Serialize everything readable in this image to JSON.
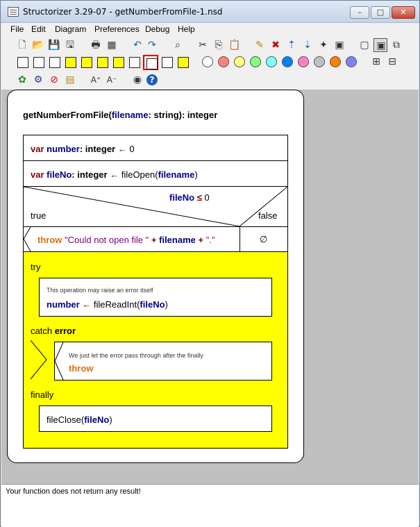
{
  "window": {
    "title": "Structorizer 3.29-07 - getNumberFromFile-1.nsd"
  },
  "menu": [
    "File",
    "Edit",
    "Diagram",
    "Preferences",
    "Debug",
    "Help"
  ],
  "toolbar": {
    "row1_icons": [
      "new-icon",
      "open-icon",
      "save-icon",
      "save-as-icon",
      "print-icon",
      "export-icon",
      "undo-icon",
      "redo-icon",
      "find-icon",
      "cut-icon",
      "copy-icon",
      "paste-icon",
      "edit-icon",
      "delete-icon",
      "move-up-icon",
      "move-down-icon",
      "transmute-icon",
      "collapse-icon",
      "view-icon-1",
      "view-icon-2",
      "view-icon-3"
    ],
    "colors": [
      "#ffffff",
      "#ff8080",
      "#ffff80",
      "#80ff80",
      "#80ffff",
      "#0080ff",
      "#ff80c0",
      "#c0c0c0",
      "#ff8000",
      "#8080ff"
    ],
    "row3_icons": [
      "turtle-icon",
      "settings-icon",
      "no-analysis-icon",
      "analysis-icon",
      "font-up-icon",
      "font-down-icon",
      "eye-icon",
      "help-icon"
    ]
  },
  "diagram": {
    "signature": {
      "name": "getNumberFromFile(",
      "param": "filename",
      "colon": ": string): integer"
    },
    "line1": {
      "var": "var",
      "name": "number",
      "type": ": integer",
      "arrow": "←",
      "value": "0"
    },
    "line2": {
      "var": "var",
      "name": "fileNo",
      "type": ": integer",
      "arrow": "←",
      "call": "fileOpen(",
      "arg": "filename",
      "close": ")"
    },
    "alt": {
      "cond_var": "fileNo",
      "cond_op": "≤",
      "cond_val": "0",
      "true_label": "true",
      "false_label": "false"
    },
    "throw_line": {
      "kw": "throw",
      "str1": "\"Could not open file \"",
      "plus1": "+",
      "arg": "filename",
      "plus2": "+",
      "str2": "\".\""
    },
    "empty_branch": "∅",
    "try": {
      "label": "try",
      "comment": "This operation may raise an error itself",
      "stmt_var": "number",
      "stmt_arrow": "←",
      "stmt_call": "fileReadInt(",
      "stmt_arg": "fileNo",
      "stmt_close": ")",
      "catch_label": "catch",
      "catch_var": "error",
      "catch_comment": "We just let the error pass through after the finally",
      "catch_stmt": "throw",
      "finally_label": "finally",
      "finally_call": "fileClose(",
      "finally_arg": "fileNo",
      "finally_close": ")"
    }
  },
  "status": {
    "message": "Your function does not return any result!"
  }
}
